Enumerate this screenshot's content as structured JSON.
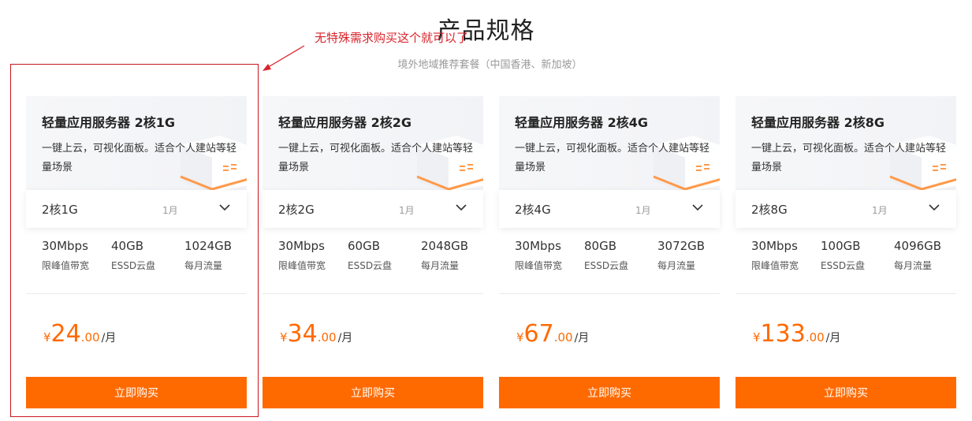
{
  "page": {
    "title": "产品规格",
    "subtitle": "境外地域推荐套餐（中国香港、新加坡）"
  },
  "annotation": {
    "text": "无特殊需求购买这个就可以了",
    "color": "#d9232b"
  },
  "colors": {
    "accent": "#ff6a00",
    "annotation": "#d9232b"
  },
  "cards": [
    {
      "name": "轻量应用服务器 2核1G",
      "desc": "一键上云，可视化面板。适合个人建站等轻量场景",
      "spec": "2核1G",
      "period": "1月",
      "metrics": [
        {
          "value": "30Mbps",
          "label": "限峰值带宽"
        },
        {
          "value": "40GB",
          "label": "ESSD云盘"
        },
        {
          "value": "1024GB",
          "label": "每月流量"
        }
      ],
      "price": {
        "currency": "¥",
        "int": "24",
        "dec": ".00",
        "unit": "/月"
      },
      "button": "立即购买"
    },
    {
      "name": "轻量应用服务器 2核2G",
      "desc": "一键上云，可视化面板。适合个人建站等轻量场景",
      "spec": "2核2G",
      "period": "1月",
      "metrics": [
        {
          "value": "30Mbps",
          "label": "限峰值带宽"
        },
        {
          "value": "60GB",
          "label": "ESSD云盘"
        },
        {
          "value": "2048GB",
          "label": "每月流量"
        }
      ],
      "price": {
        "currency": "¥",
        "int": "34",
        "dec": ".00",
        "unit": "/月"
      },
      "button": "立即购买"
    },
    {
      "name": "轻量应用服务器 2核4G",
      "desc": "一键上云，可视化面板。适合个人建站等轻量场景",
      "spec": "2核4G",
      "period": "1月",
      "metrics": [
        {
          "value": "30Mbps",
          "label": "限峰值带宽"
        },
        {
          "value": "80GB",
          "label": "ESSD云盘"
        },
        {
          "value": "3072GB",
          "label": "每月流量"
        }
      ],
      "price": {
        "currency": "¥",
        "int": "67",
        "dec": ".00",
        "unit": "/月"
      },
      "button": "立即购买"
    },
    {
      "name": "轻量应用服务器 2核8G",
      "desc": "一键上云，可视化面板。适合个人建站等轻量场景",
      "spec": "2核8G",
      "period": "1月",
      "metrics": [
        {
          "value": "30Mbps",
          "label": "限峰值带宽"
        },
        {
          "value": "100GB",
          "label": "ESSD云盘"
        },
        {
          "value": "4096GB",
          "label": "每月流量"
        }
      ],
      "price": {
        "currency": "¥",
        "int": "133",
        "dec": ".00",
        "unit": "/月"
      },
      "button": "立即购买"
    }
  ]
}
